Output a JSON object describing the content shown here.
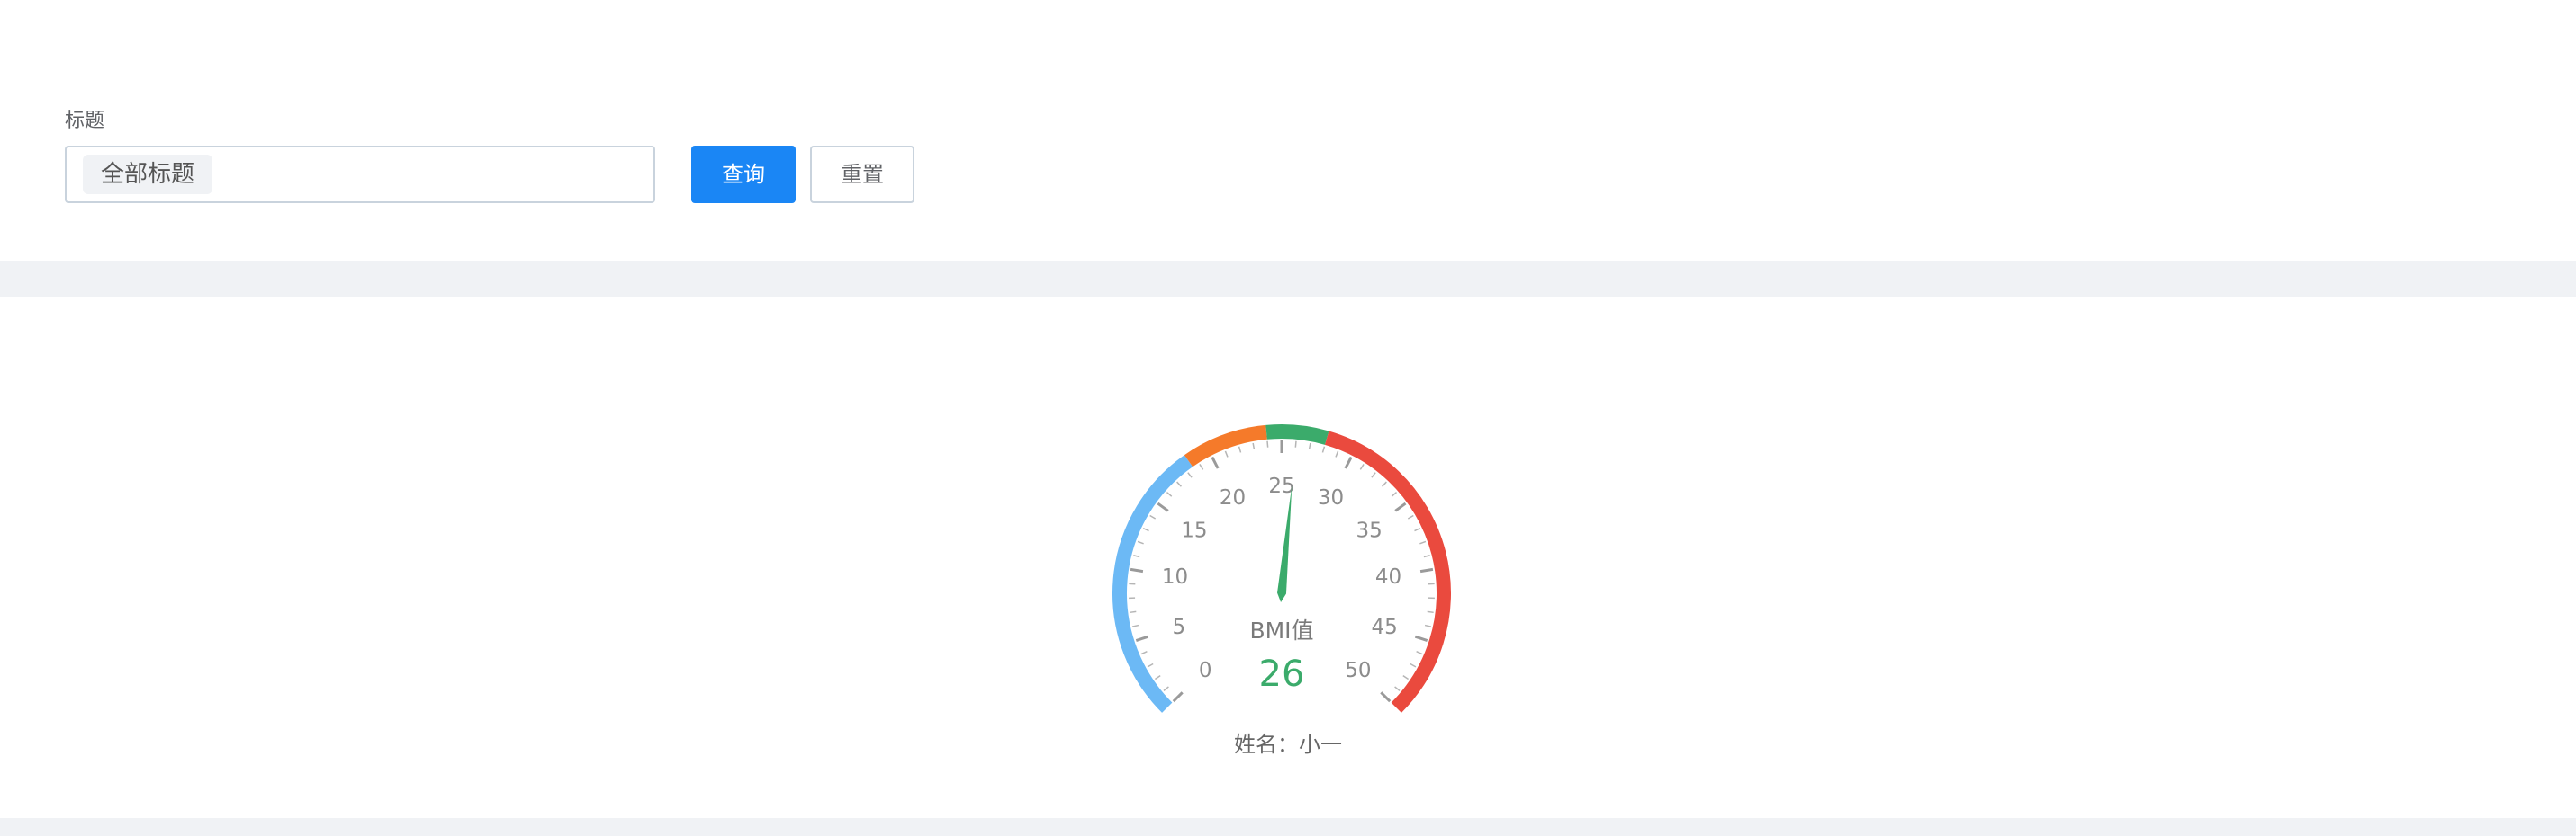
{
  "filter": {
    "field_label": "标题",
    "select_value": "全部标题",
    "query_label": "查询",
    "reset_label": "重置"
  },
  "chart_data": {
    "type": "gauge",
    "title": "",
    "value_label": "BMI值",
    "value": 26,
    "min": 0,
    "max": 50,
    "major_ticks": [
      0,
      5,
      10,
      15,
      20,
      25,
      30,
      35,
      40,
      45,
      50
    ],
    "bands": [
      {
        "from": 0,
        "to": 18.5,
        "color": "#6cb9f5"
      },
      {
        "from": 18.5,
        "to": 24,
        "color": "#f57a2a"
      },
      {
        "from": 24,
        "to": 28,
        "color": "#3bab6b"
      },
      {
        "from": 28,
        "to": 50,
        "color": "#ea4a3e"
      }
    ],
    "value_color": "#3bab6b"
  },
  "caption": {
    "name_prefix": "姓名：",
    "name_value": "小一"
  }
}
